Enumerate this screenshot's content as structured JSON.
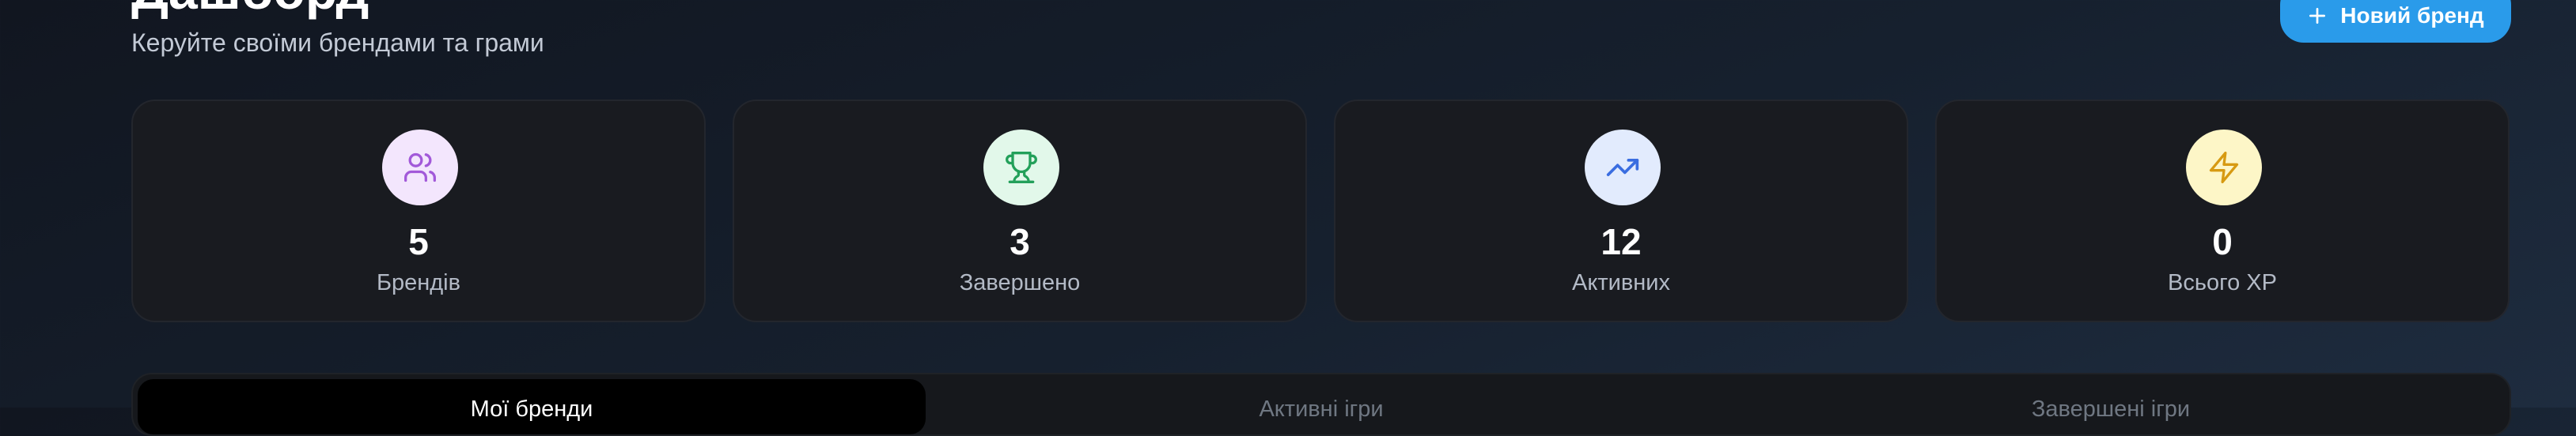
{
  "header": {
    "title": "Дашборд",
    "subtitle": "Керуйте своїми брендами та грами",
    "new_brand_label": "Новий бренд"
  },
  "stats": [
    {
      "value": "5",
      "label": "Брендів",
      "icon": "users-icon",
      "color": "#a259d9",
      "bg": "#f3e6fd"
    },
    {
      "value": "3",
      "label": "Завершено",
      "icon": "trophy-icon",
      "color": "#23a05a",
      "bg": "#e2f8ea"
    },
    {
      "value": "12",
      "label": "Активних",
      "icon": "trending-up-icon",
      "color": "#3a6de0",
      "bg": "#e2ebfd"
    },
    {
      "value": "0",
      "label": "Всього XP",
      "icon": "zap-icon",
      "color": "#d79a12",
      "bg": "#fdf6c7"
    }
  ],
  "tabs": [
    {
      "label": "Мої бренди",
      "active": true
    },
    {
      "label": "Активні ігри",
      "active": false
    },
    {
      "label": "Завершені ігри",
      "active": false
    }
  ],
  "colors": {
    "accent": "#2a9bea",
    "background": "#131923",
    "card": "#191b20"
  }
}
